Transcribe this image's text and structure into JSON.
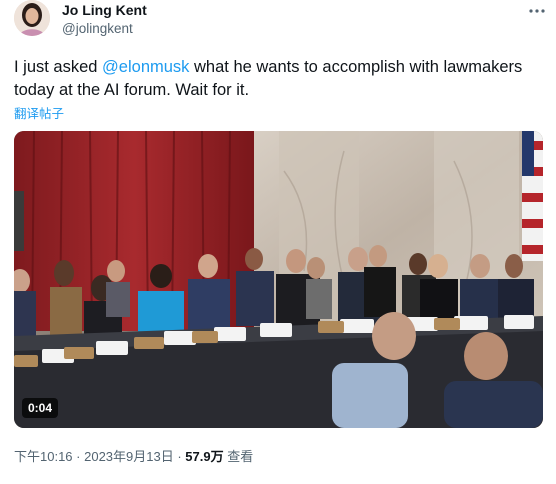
{
  "author": {
    "name": "Jo Ling Kent",
    "handle": "@jolingkent"
  },
  "tweet": {
    "text_before": "I just asked ",
    "mention": "@elonmusk",
    "text_after": " what he wants to accomplish with lawmakers today at the AI forum. Wait for it.",
    "translate_label": "翻译帖子"
  },
  "media": {
    "type": "video",
    "duration": "0:04"
  },
  "meta": {
    "time": "下午10:16",
    "separator": " · ",
    "date": "2023年9月13日",
    "views_count": "57.9万",
    "views_label": "查看"
  },
  "icons": {
    "more": "more-horizontal-icon"
  },
  "colors": {
    "link": "#1d9bf0",
    "secondary_text": "#536471",
    "primary_text": "#0f1419"
  }
}
